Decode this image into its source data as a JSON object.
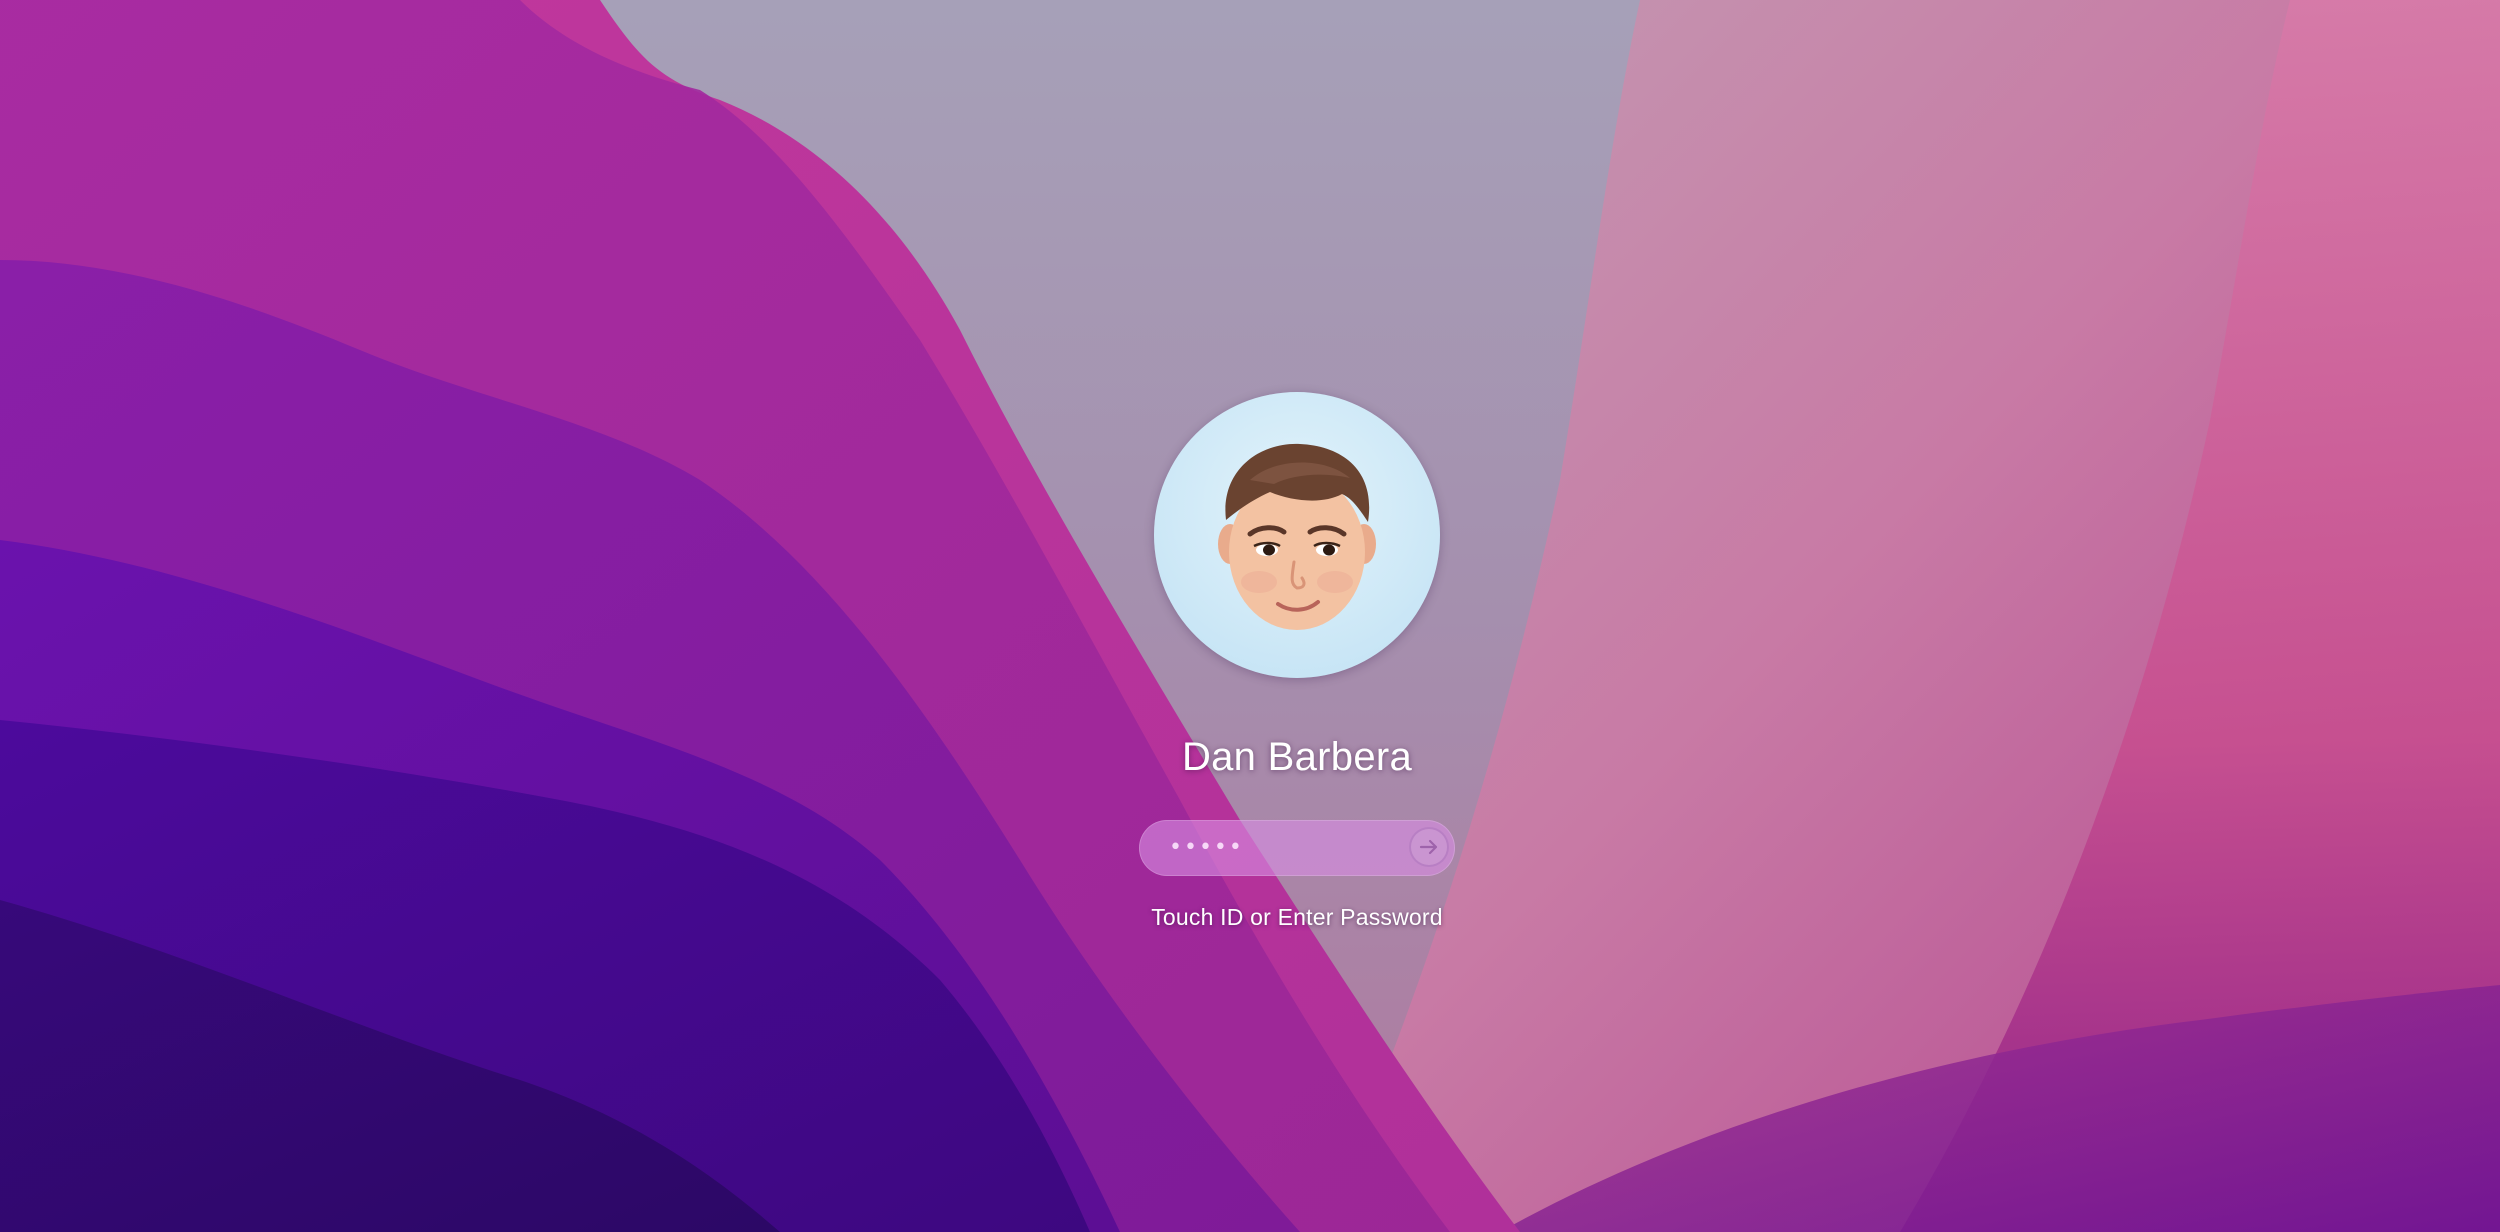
{
  "user": {
    "name": "Dan Barbera"
  },
  "password": {
    "masked_value": "•••••"
  },
  "hint": "Touch ID or Enter Password",
  "icons": {
    "submit": "arrow-right-circle-icon",
    "avatar": "memoji-avatar"
  },
  "colors": {
    "avatar_background": "#cfe9f7",
    "field_background": "#d68ce2",
    "wallpaper_left": "#4a0fa0",
    "wallpaper_center": "#a89ab6",
    "wallpaper_right": "#d0609a"
  }
}
